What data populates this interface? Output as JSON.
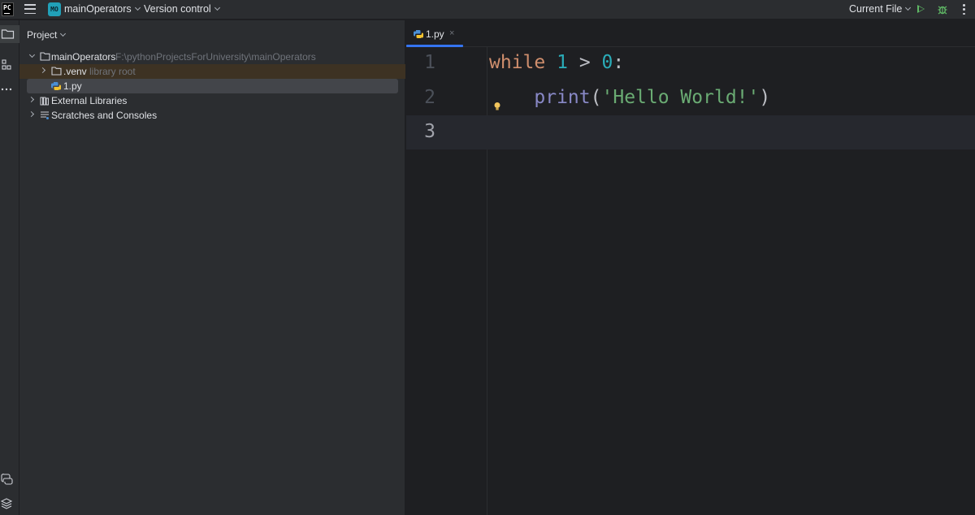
{
  "titlebar": {
    "app_logo": "PC",
    "project_badge": "MO",
    "project_name": "mainOperators",
    "version_control": "Version control",
    "run_config": "Current File"
  },
  "project_panel": {
    "title": "Project",
    "tree": {
      "root_name": "mainOperators",
      "root_path": "F:\\pythonProjectsForUniversity\\mainOperators",
      "venv_name": ".venv",
      "venv_hint": "library root",
      "file_name": "1.py",
      "external_libraries": "External Libraries",
      "scratches": "Scratches and Consoles"
    }
  },
  "editor": {
    "tab_label": "1.py",
    "tab_close": "×",
    "line_numbers": [
      "1",
      "2",
      "3"
    ],
    "code": {
      "line1_kw": "while",
      "line1_num1": "1",
      "line1_op": " > ",
      "line1_num2": "0",
      "line1_colon": ":",
      "line2_indent": "    ",
      "line2_fn": "print",
      "line2_open": "(",
      "line2_str": "'Hello World!'",
      "line2_close": ")"
    }
  },
  "icons": {
    "app": "pycharm-logo-icon",
    "menu": "hamburger-menu-icon",
    "run": "run-icon",
    "debug": "debug-icon",
    "more": "more-vertical-icon",
    "project_tool": "folder-icon",
    "structure": "structure-icon",
    "more_tools": "more-horizontal-icon",
    "python_console": "python-console-icon",
    "layers": "layers-icon",
    "intention": "lightbulb-icon"
  },
  "colors": {
    "accent": "#3574f0",
    "keyword": "#cf8e6d",
    "number": "#2aacb8",
    "builtin": "#8888c6",
    "string": "#6aab73"
  }
}
